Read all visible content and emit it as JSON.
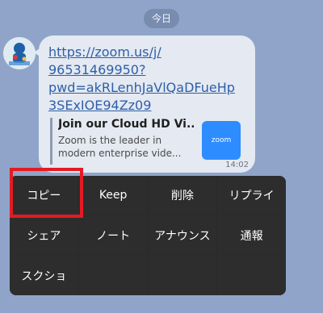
{
  "chat": {
    "date_label": "今日",
    "message": {
      "url": "https://zoom.us/j/\n96531469950?\npwd=akRLenhJaVlQaDFueHp\n3SExIOE94Zz09",
      "preview_title": "Join our Cloud HD Vi...",
      "preview_description": "Zoom is the leader in\nmodern enterprise vide...",
      "thumbnail_text": "zoom",
      "time": "14:02"
    }
  },
  "menu": {
    "items": [
      {
        "label": "コピー",
        "highlighted": true
      },
      {
        "label": "Keep"
      },
      {
        "label": "削除"
      },
      {
        "label": "リプライ"
      },
      {
        "label": "シェア"
      },
      {
        "label": "ノート"
      },
      {
        "label": "アナウンス"
      },
      {
        "label": "通報"
      },
      {
        "label": "スクショ"
      }
    ]
  },
  "colors": {
    "background": "#8fa4c8",
    "bubble": "#e4e9f2",
    "link": "#2f5fa7",
    "menu": "#2d2d2d",
    "highlight_border": "#e31b23",
    "zoom_blue": "#2d8cff"
  },
  "icons": {
    "avatar": "profile-photo-icon"
  }
}
